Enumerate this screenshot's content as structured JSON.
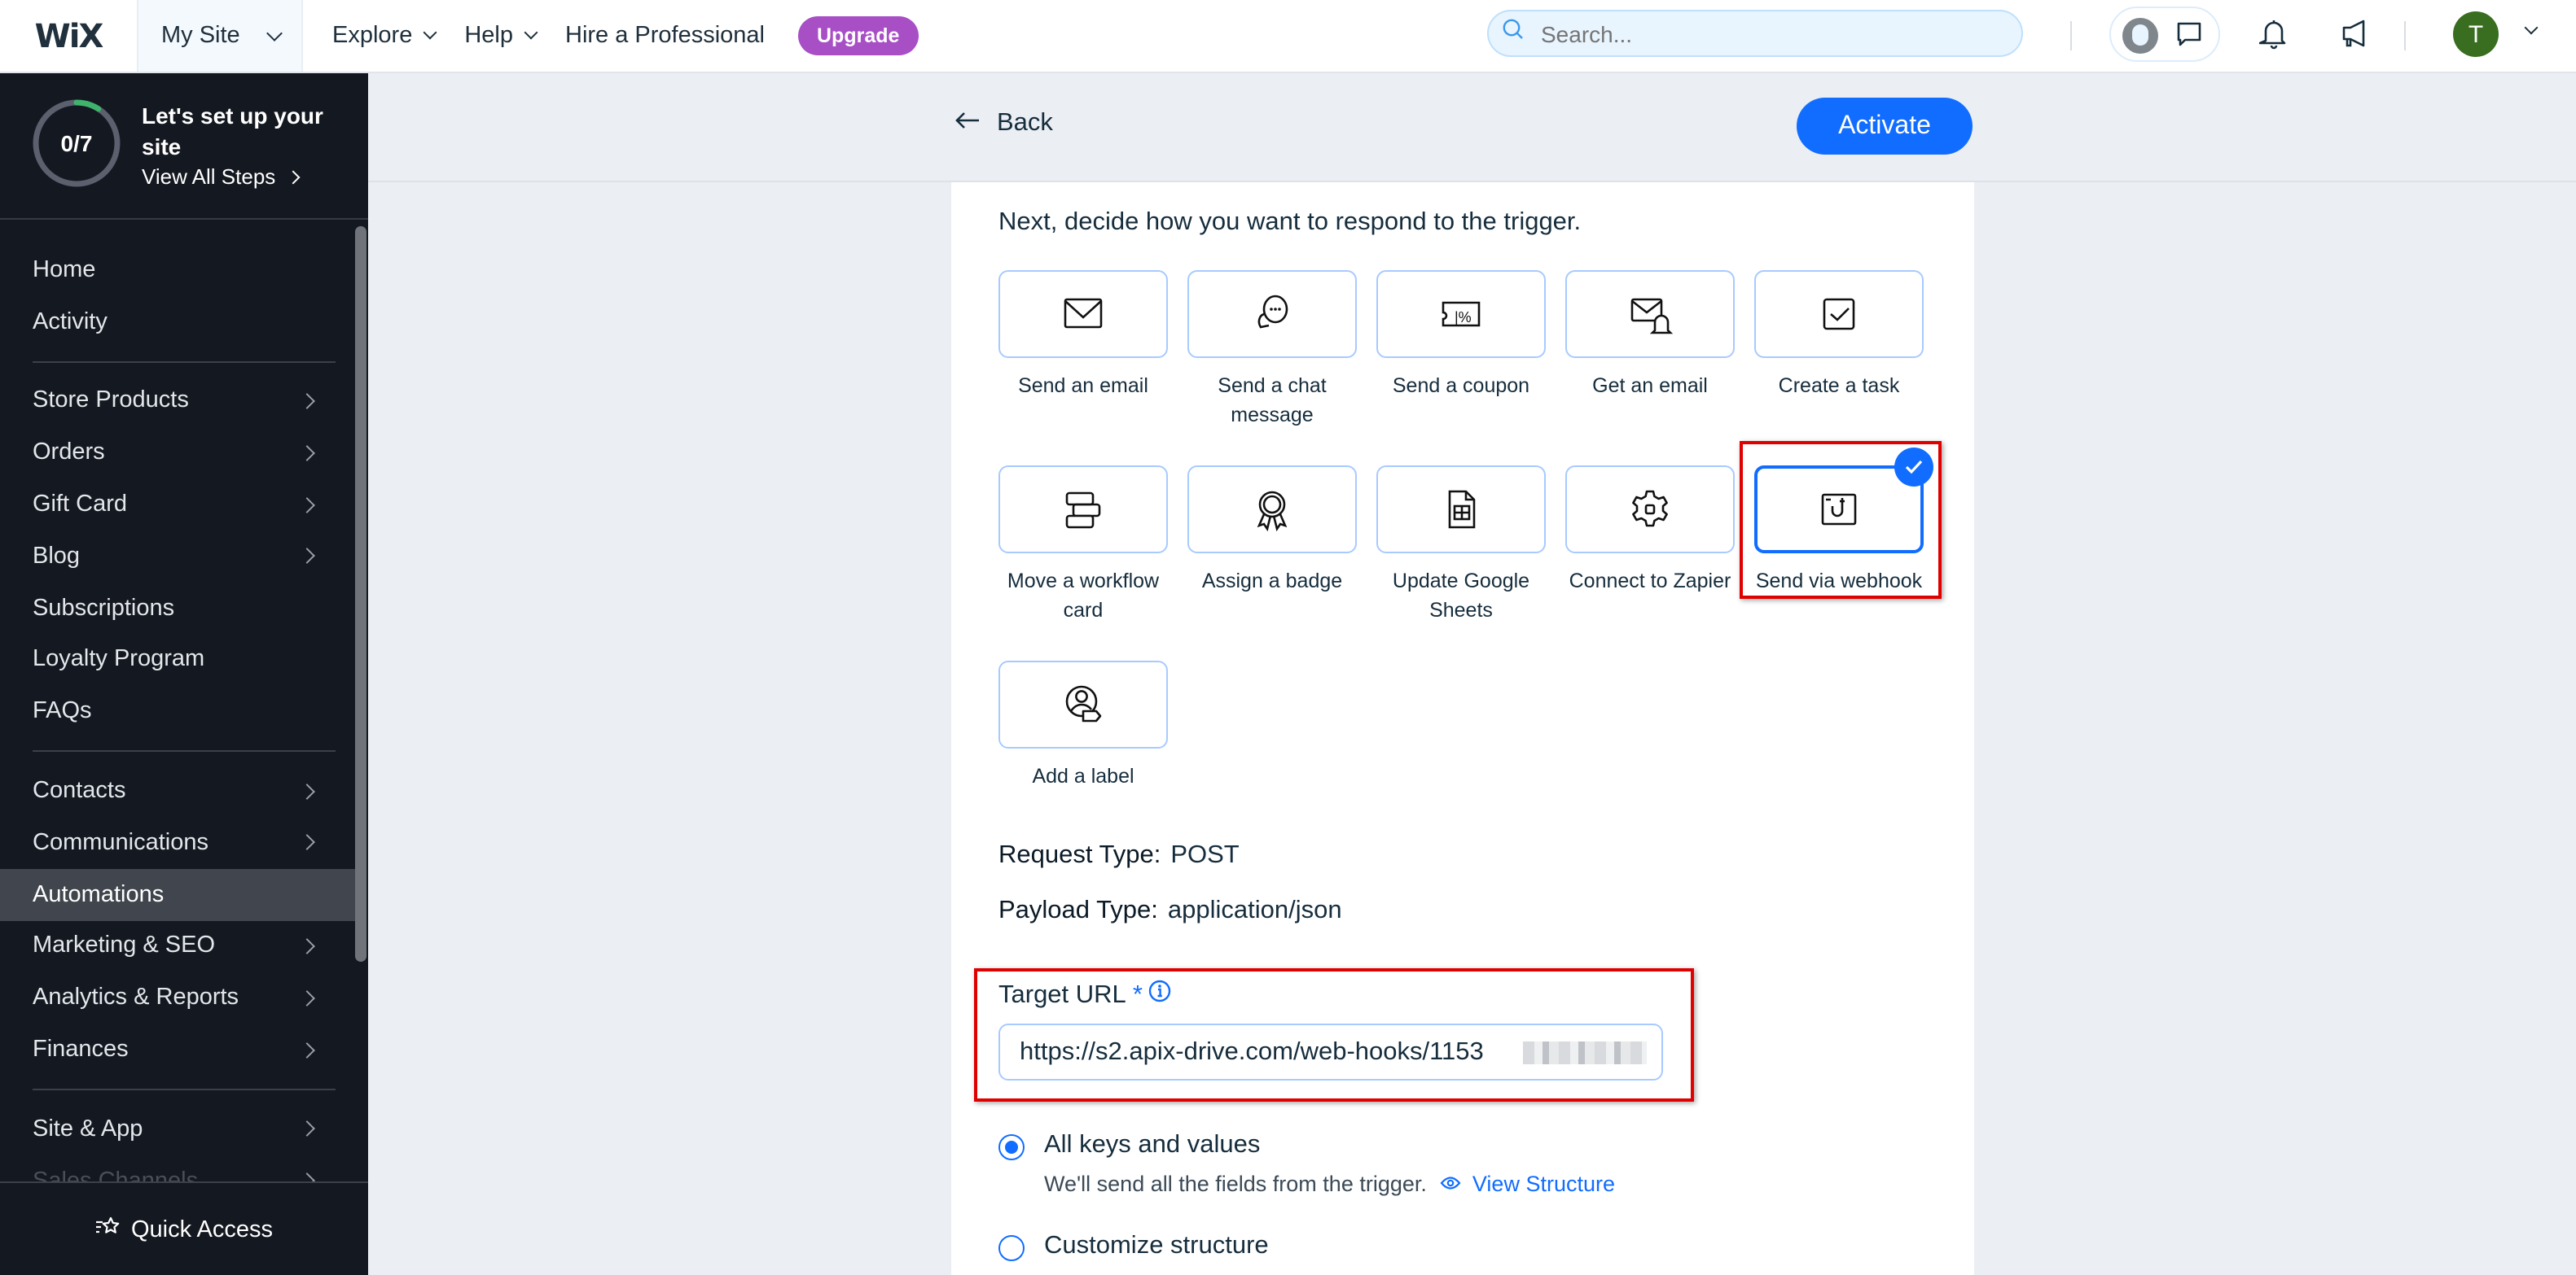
{
  "topbar": {
    "logo": "WiX",
    "site_menu": "My Site",
    "nav": [
      {
        "label": "Explore",
        "has_dropdown": true
      },
      {
        "label": "Help",
        "has_dropdown": true
      },
      {
        "label": "Hire a Professional",
        "has_dropdown": false
      }
    ],
    "upgrade_label": "Upgrade",
    "search_placeholder": "Search...",
    "user_initial": "T",
    "icons": [
      "search-icon",
      "community-avatar-icon",
      "chat-icon",
      "bell-icon",
      "megaphone-icon",
      "chevron-down-icon"
    ]
  },
  "sidebar": {
    "setup": {
      "progress_text": "0/7",
      "progress_completed": 0,
      "progress_total": 7,
      "title": "Let's set up your site",
      "link": "View All Steps"
    },
    "groups": [
      [
        {
          "label": "Home",
          "arrow": false
        },
        {
          "label": "Activity",
          "arrow": false
        }
      ],
      [
        {
          "label": "Store Products",
          "arrow": true
        },
        {
          "label": "Orders",
          "arrow": true
        },
        {
          "label": "Gift Card",
          "arrow": true
        },
        {
          "label": "Blog",
          "arrow": true
        },
        {
          "label": "Subscriptions",
          "arrow": false
        },
        {
          "label": "Loyalty Program",
          "arrow": false
        },
        {
          "label": "FAQs",
          "arrow": false
        }
      ],
      [
        {
          "label": "Contacts",
          "arrow": true
        },
        {
          "label": "Communications",
          "arrow": true
        },
        {
          "label": "Automations",
          "arrow": false,
          "active": true
        },
        {
          "label": "Marketing & SEO",
          "arrow": true
        },
        {
          "label": "Analytics & Reports",
          "arrow": true
        },
        {
          "label": "Finances",
          "arrow": true
        }
      ],
      [
        {
          "label": "Site & App",
          "arrow": true
        },
        {
          "label": "Sales Channels",
          "arrow": true,
          "faded": true
        }
      ]
    ],
    "quick_access": "Quick Access"
  },
  "header": {
    "back_label": "Back",
    "activate_label": "Activate"
  },
  "main": {
    "intro": "Next, decide how you want to respond to the trigger.",
    "actions": [
      {
        "label": "Send an email",
        "icon": "envelope-icon"
      },
      {
        "label": "Send a chat message",
        "icon": "chat-bubbles-icon"
      },
      {
        "label": "Send a coupon",
        "icon": "coupon-icon"
      },
      {
        "label": "Get an email",
        "icon": "email-notification-icon"
      },
      {
        "label": "Create a task",
        "icon": "task-checkbox-icon"
      },
      {
        "label": "Move a workflow card",
        "icon": "workflow-cards-icon"
      },
      {
        "label": "Assign a badge",
        "icon": "badge-ribbon-icon"
      },
      {
        "label": "Update Google Sheets",
        "icon": "spreadsheet-icon"
      },
      {
        "label": "Connect to Zapier",
        "icon": "gear-icon"
      },
      {
        "label": "Send via webhook",
        "icon": "webhook-icon",
        "selected": true
      },
      {
        "label": "Add a label",
        "icon": "contact-label-icon"
      }
    ],
    "request_type": {
      "key": "Request Type:",
      "value": "POST"
    },
    "payload_type": {
      "key": "Payload Type:",
      "value": "application/json"
    },
    "target_url": {
      "label": "Target URL",
      "required_mark": "*",
      "value": "https://s2.apix-drive.com/web-hooks/1153"
    },
    "structure_options": [
      {
        "label": "All keys and values",
        "selected": true,
        "hint": "We'll send all the fields from the trigger.",
        "link": "View Structure"
      },
      {
        "label": "Customize structure",
        "selected": false
      }
    ]
  },
  "colors": {
    "accent": "#116dff",
    "upgrade": "#a84fc6",
    "sidebar_bg": "#141820",
    "highlight_box": "#e00000",
    "avatar": "#396d1f",
    "progress": "#3fb36c"
  }
}
